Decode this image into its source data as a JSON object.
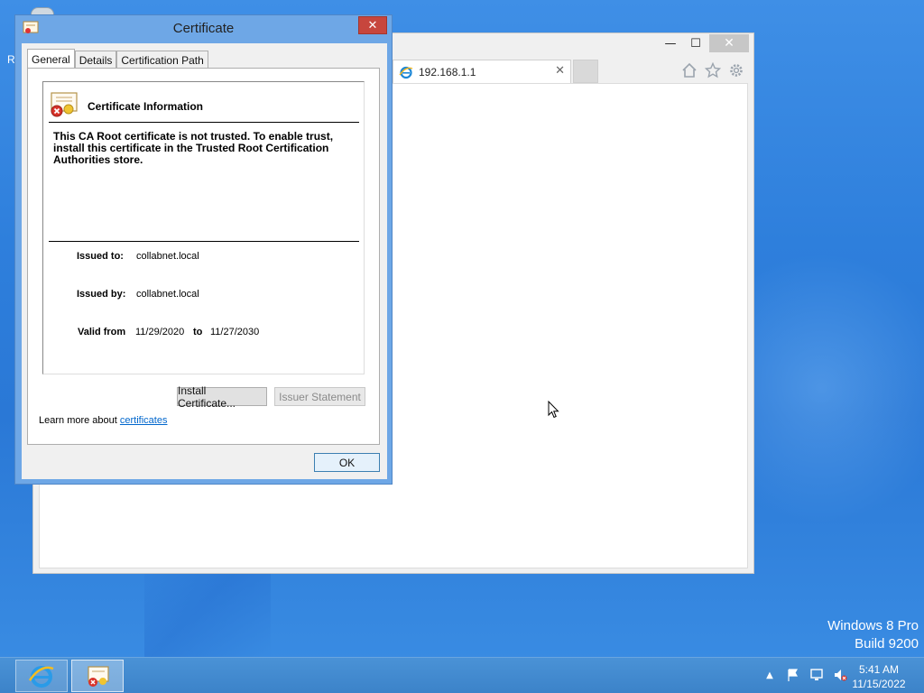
{
  "browser": {
    "tab_title": "192.168.1.1",
    "tab_close_glyph": "✕",
    "min_glyph": "—",
    "max_glyph": "☐",
    "close_glyph": "✕",
    "icons": [
      "home-icon",
      "star-icon",
      "gear-icon"
    ]
  },
  "desktop": {
    "partial_label": "R"
  },
  "certificate": {
    "title": "Certificate",
    "close_glyph": "✕",
    "tabs": [
      "General",
      "Details",
      "Certification Path"
    ],
    "active_tab": "General",
    "heading": "Certificate Information",
    "warning": "This CA Root certificate is not trusted. To enable trust, install this certificate in the Trusted Root Certification Authorities store.",
    "issued_to_label": "Issued to:",
    "issued_to": "collabnet.local",
    "issued_by_label": "Issued by:",
    "issued_by": "collabnet.local",
    "valid_from_label": "Valid from",
    "valid_from": "11/29/2020",
    "valid_to_label": "to",
    "valid_to": "11/27/2030",
    "install_button": "Install Certificate...",
    "issuer_button": "Issuer Statement",
    "learn_more_prefix": "Learn more about",
    "learn_more_link": "certificates",
    "ok_button": "OK"
  },
  "watermark": {
    "line1": "Windows 8 Pro",
    "line2": "Build 9200"
  },
  "taskbar": {
    "time": "5:41 AM",
    "date": "11/15/2022",
    "tray_icons": [
      "show-hidden-icons",
      "action-center-flag-icon",
      "network-icon",
      "volume-muted-icon"
    ],
    "colors": {
      "accent": "#3c83c9",
      "close_red": "#c7463d",
      "link": "#0066cc"
    }
  }
}
